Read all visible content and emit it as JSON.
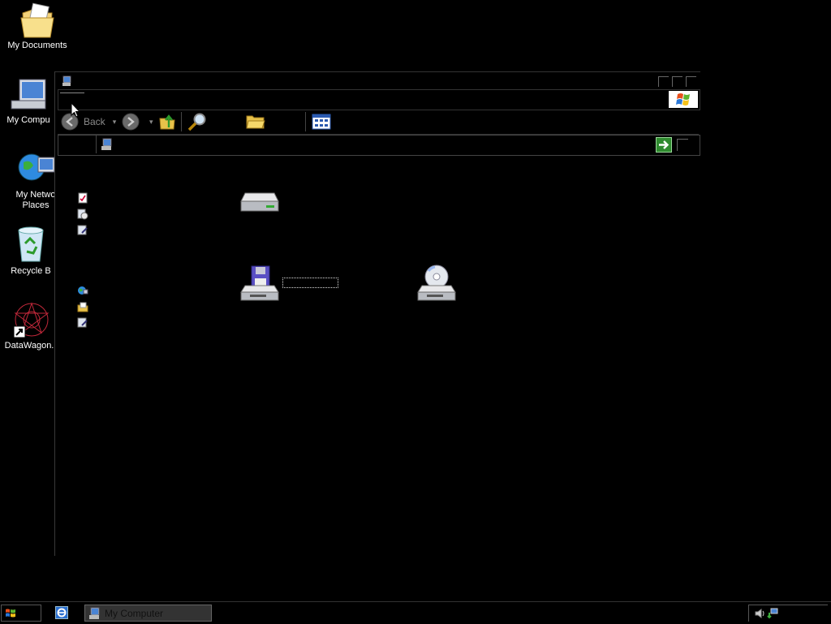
{
  "desktop": {
    "icons": [
      {
        "label": "My Documents",
        "icon": "folder-documents-icon"
      },
      {
        "label": "My Compu",
        "icon": "my-computer-icon"
      },
      {
        "label": "My Netwo Places",
        "icon": "network-places-icon"
      },
      {
        "label": "Recycle B",
        "icon": "recycle-bin-icon"
      },
      {
        "label": "DataWagon.",
        "icon": "datawagon-shortcut-icon"
      }
    ]
  },
  "window": {
    "title_icon": "my-computer-icon",
    "toolbar": {
      "back_label": "Back",
      "back_arrow": "▾",
      "forward_arrow": "▾"
    },
    "address": {
      "icon": "my-computer-icon",
      "value": ""
    },
    "sidebar_icons": [
      "system-info-icon",
      "add-remove-programs-icon",
      "change-setting-icon",
      "network-places-icon",
      "my-documents-icon",
      "control-panel-icon"
    ],
    "drives": [
      {
        "icon": "hard-disk-icon"
      },
      {
        "icon": "floppy-drive-icon"
      },
      {
        "icon": "cd-drive-icon"
      }
    ]
  },
  "taskbar": {
    "task_label": "My Computer",
    "tray_icons": [
      "volume-icon",
      "network-icon"
    ]
  }
}
